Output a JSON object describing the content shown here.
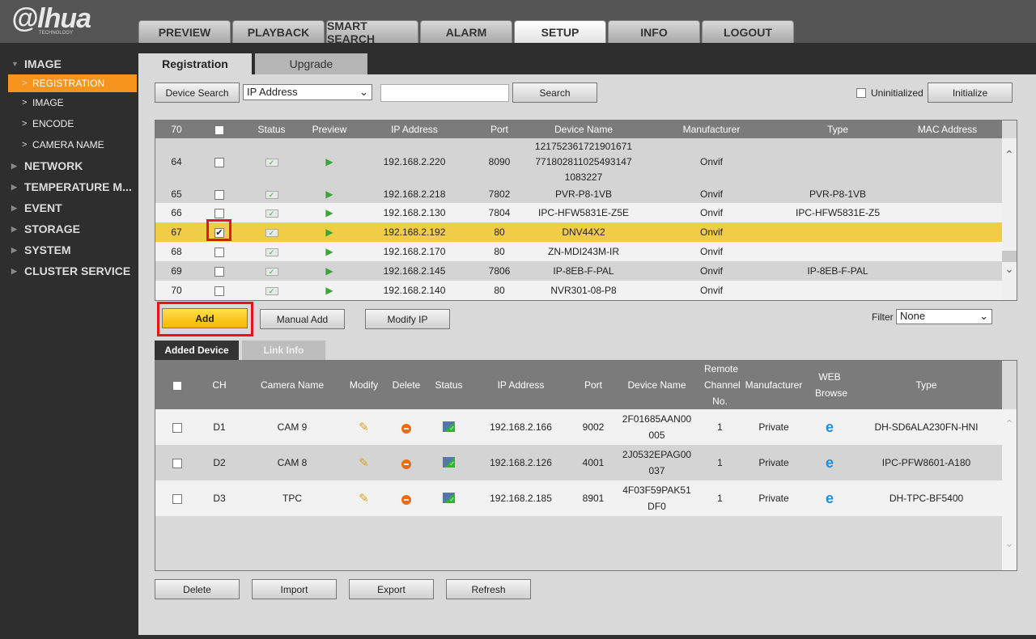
{
  "brand": {
    "logo": "alhua",
    "sub": "TECHNOLOGY"
  },
  "nav": [
    "PREVIEW",
    "PLAYBACK",
    "SMART SEARCH",
    "ALARM",
    "SETUP",
    "INFO",
    "LOGOUT"
  ],
  "nav_active": "SETUP",
  "sidebar": [
    {
      "label": "IMAGE",
      "type": "open"
    },
    {
      "label": "REGISTRATION",
      "type": "sub",
      "selected": true
    },
    {
      "label": "IMAGE",
      "type": "sub"
    },
    {
      "label": "ENCODE",
      "type": "sub"
    },
    {
      "label": "CAMERA NAME",
      "type": "sub"
    },
    {
      "label": "NETWORK",
      "type": "closed"
    },
    {
      "label": "TEMPERATURE M...",
      "type": "closed"
    },
    {
      "label": "EVENT",
      "type": "closed"
    },
    {
      "label": "STORAGE",
      "type": "closed"
    },
    {
      "label": "SYSTEM",
      "type": "closed"
    },
    {
      "label": "CLUSTER SERVICE",
      "type": "closed"
    }
  ],
  "tabs": {
    "registration": "Registration",
    "upgrade": "Upgrade"
  },
  "search": {
    "device_search": "Device Search",
    "type_value": "IP Address",
    "query": "",
    "search": "Search",
    "uninit_label": "Uninitialized",
    "initialize": "Initialize"
  },
  "devices": {
    "headers": [
      "70",
      "",
      "Status",
      "Preview",
      "IP Address",
      "Port",
      "Device Name",
      "Manufacturer",
      "Type",
      "MAC Address"
    ],
    "rows": [
      {
        "no": "64",
        "checked": false,
        "ip": "192.168.2.220",
        "port": "8090",
        "name": "1217523617219016717718028110254931471083227",
        "mfr": "Onvif",
        "type": "",
        "mac": ""
      },
      {
        "no": "65",
        "checked": false,
        "ip": "192.168.2.218",
        "port": "7802",
        "name": "PVR-P8-1VB",
        "mfr": "Onvif",
        "type": "PVR-P8-1VB",
        "mac": ""
      },
      {
        "no": "66",
        "checked": false,
        "ip": "192.168.2.130",
        "port": "7804",
        "name": "IPC-HFW5831E-Z5E",
        "mfr": "Onvif",
        "type": "IPC-HFW5831E-Z5",
        "mac": ""
      },
      {
        "no": "67",
        "checked": true,
        "ip": "192.168.2.192",
        "port": "80",
        "name": "DNV44X2",
        "mfr": "Onvif",
        "type": "",
        "mac": ""
      },
      {
        "no": "68",
        "checked": false,
        "ip": "192.168.2.170",
        "port": "80",
        "name": "ZN-MDI243M-IR",
        "mfr": "Onvif",
        "type": "",
        "mac": ""
      },
      {
        "no": "69",
        "checked": false,
        "ip": "192.168.2.145",
        "port": "7806",
        "name": "IP-8EB-F-PAL",
        "mfr": "Onvif",
        "type": "IP-8EB-F-PAL",
        "mac": ""
      },
      {
        "no": "70",
        "checked": false,
        "ip": "192.168.2.140",
        "port": "80",
        "name": "NVR301-08-P8",
        "mfr": "Onvif",
        "type": "",
        "mac": ""
      }
    ]
  },
  "actions": {
    "add": "Add",
    "manual_add": "Manual Add",
    "modify_ip": "Modify IP",
    "filter_label": "Filter",
    "filter_value": "None"
  },
  "tabs2": {
    "added": "Added Device",
    "link": "Link Info"
  },
  "added": {
    "headers": [
      "",
      "CH",
      "Camera Name",
      "Modify",
      "Delete",
      "Status",
      "IP Address",
      "Port",
      "Device Name",
      "Remote Channel No.",
      "Manufacturer",
      "WEB Browse",
      "Type"
    ],
    "rows": [
      {
        "ch": "D1",
        "cam": "CAM 9",
        "ip": "192.168.2.166",
        "port": "9002",
        "name": "2F01685AAN00005",
        "remote": "1",
        "mfr": "Private",
        "type": "DH-SD6ALA230FN-HNI"
      },
      {
        "ch": "D2",
        "cam": "CAM 8",
        "ip": "192.168.2.126",
        "port": "4001",
        "name": "2J0532EPAG00037",
        "remote": "1",
        "mfr": "Private",
        "type": "IPC-PFW8601-A180"
      },
      {
        "ch": "D3",
        "cam": "TPC",
        "ip": "192.168.2.185",
        "port": "8901",
        "name": "4F03F59PAK51DF0",
        "remote": "1",
        "mfr": "Private",
        "type": "DH-TPC-BF5400"
      }
    ]
  },
  "bottom": [
    "Delete",
    "Import",
    "Export",
    "Refresh"
  ],
  "colors": {
    "accent": "#f7941d",
    "highlight": "#f1cc46",
    "add": "#f5c518",
    "callout": "#e8141c"
  }
}
